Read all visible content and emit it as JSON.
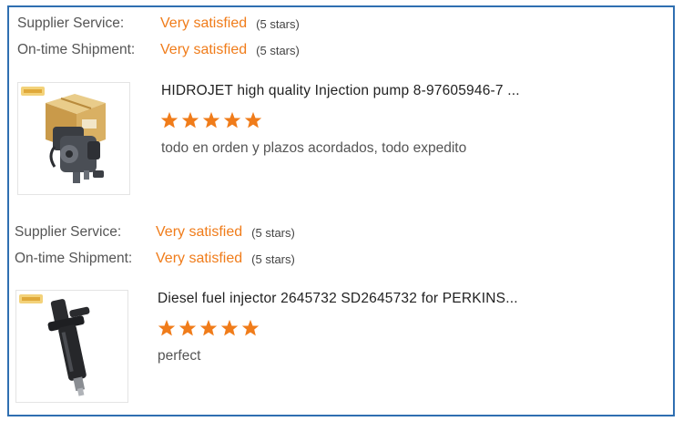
{
  "colors": {
    "accent": "#f07c1a",
    "border": "#2f6fb1",
    "text": "#222222",
    "muted": "#555555"
  },
  "reviews": [
    {
      "supplier_service_label": "Supplier Service:",
      "supplier_service_value": "Very satisfied",
      "supplier_service_stars": "(5 stars)",
      "shipment_label": "On-time Shipment:",
      "shipment_value": "Very satisfied",
      "shipment_stars": "(5 stars)",
      "image_icon": "injection-pump-with-box",
      "product_title": "HIDROJET high quality Injection pump 8-97605946-7 ...",
      "rating": 5,
      "comment": "todo en orden y plazos acordados, todo expedito"
    },
    {
      "supplier_service_label": "Supplier Service:",
      "supplier_service_value": "Very satisfied",
      "supplier_service_stars": "(5 stars)",
      "shipment_label": "On-time Shipment:",
      "shipment_value": "Very satisfied",
      "shipment_stars": "(5 stars)",
      "image_icon": "diesel-fuel-injector",
      "product_title": "Diesel fuel injector 2645732 SD2645732 for PERKINS...",
      "rating": 5,
      "comment": "perfect"
    }
  ]
}
